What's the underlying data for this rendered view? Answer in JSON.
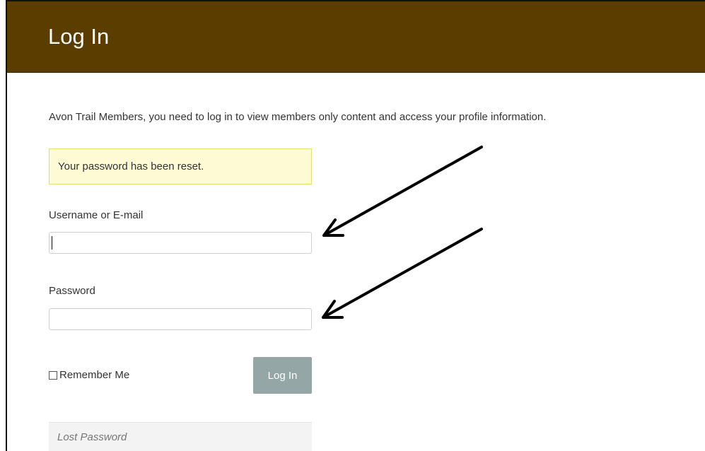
{
  "header": {
    "title": "Log In",
    "background_color": "#5c3d00"
  },
  "intro_text": "Avon Trail Members, you need to log in to view members only content and access your profile information.",
  "notice": {
    "message": "Your password has been reset."
  },
  "form": {
    "username_label": "Username or E-mail",
    "username_value": "",
    "password_label": "Password",
    "password_value": "",
    "remember_label": "Remember Me",
    "remember_checked": false,
    "submit_label": "Log In",
    "submit_color": "#94a6a6"
  },
  "lost_password_link": "Lost Password",
  "annotations": {
    "arrows": [
      "arrow-icon",
      "arrow-icon"
    ]
  }
}
